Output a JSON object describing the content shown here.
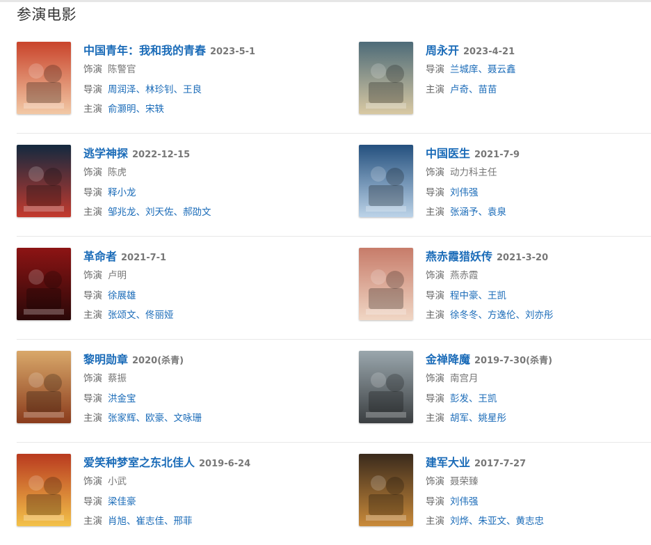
{
  "section": {
    "title": "参演电影"
  },
  "labels": {
    "role": "饰演",
    "director": "导演",
    "star": "主演"
  },
  "movies": [
    {
      "title": "中国青年：我和我的青春",
      "date": "2023-5-1",
      "lines": [
        {
          "type": "role",
          "label": "饰演",
          "items": [
            "陈警官"
          ]
        },
        {
          "type": "director",
          "label": "导演",
          "items": [
            "周润泽",
            "林珍钊",
            "王良"
          ]
        },
        {
          "type": "star",
          "label": "主演",
          "items": [
            "俞灏明",
            "宋轶"
          ]
        }
      ],
      "poster": {
        "icon": "movie-poster",
        "bg": "#c9442b",
        "bg2": "#f2c9a6"
      }
    },
    {
      "title": "周永开",
      "date": "2023-4-21",
      "lines": [
        {
          "type": "director",
          "label": "导演",
          "items": [
            "兰城庠",
            "聂云鑫"
          ]
        },
        {
          "type": "star",
          "label": "主演",
          "items": [
            "卢奇",
            "苗苗"
          ]
        }
      ],
      "poster": {
        "icon": "movie-poster",
        "bg": "#4d6b78",
        "bg2": "#d9c9a3"
      }
    },
    {
      "title": "逃学神探",
      "date": "2022-12-15",
      "lines": [
        {
          "type": "role",
          "label": "饰演",
          "items": [
            "陈虎"
          ]
        },
        {
          "type": "director",
          "label": "导演",
          "items": [
            "释小龙"
          ]
        },
        {
          "type": "star",
          "label": "主演",
          "items": [
            "邹兆龙",
            "刘天佐",
            "郝劭文"
          ]
        }
      ],
      "poster": {
        "icon": "movie-poster",
        "bg": "#13293f",
        "bg2": "#c43a2e"
      }
    },
    {
      "title": "中国医生",
      "date": "2021-7-9",
      "lines": [
        {
          "type": "role",
          "label": "饰演",
          "items": [
            "动力科主任"
          ]
        },
        {
          "type": "director",
          "label": "导演",
          "items": [
            "刘伟强"
          ]
        },
        {
          "type": "star",
          "label": "主演",
          "items": [
            "张涵予",
            "袁泉"
          ]
        }
      ],
      "poster": {
        "icon": "movie-poster",
        "bg": "#24507e",
        "bg2": "#bcd3e8"
      }
    },
    {
      "title": "革命者",
      "date": "2021-7-1",
      "lines": [
        {
          "type": "role",
          "label": "饰演",
          "items": [
            "卢明"
          ]
        },
        {
          "type": "director",
          "label": "导演",
          "items": [
            "徐展雄"
          ]
        },
        {
          "type": "star",
          "label": "主演",
          "items": [
            "张颂文",
            "佟丽娅"
          ]
        }
      ],
      "poster": {
        "icon": "movie-poster",
        "bg": "#8d1414",
        "bg2": "#2a0808"
      }
    },
    {
      "title": "燕赤霞猎妖传",
      "date": "2021-3-20",
      "lines": [
        {
          "type": "role",
          "label": "饰演",
          "items": [
            "燕赤霞"
          ]
        },
        {
          "type": "director",
          "label": "导演",
          "items": [
            "程中豪",
            "王凯"
          ]
        },
        {
          "type": "star",
          "label": "主演",
          "items": [
            "徐冬冬",
            "方逸伦",
            "刘亦彤"
          ]
        }
      ],
      "poster": {
        "icon": "movie-poster",
        "bg": "#c77c6a",
        "bg2": "#f0d6c4"
      }
    },
    {
      "title": "黎明勋章",
      "date": "2020(杀青)",
      "lines": [
        {
          "type": "role",
          "label": "饰演",
          "items": [
            "蔡振"
          ]
        },
        {
          "type": "director",
          "label": "导演",
          "items": [
            "洪金宝"
          ]
        },
        {
          "type": "star",
          "label": "主演",
          "items": [
            "张家辉",
            "欧豪",
            "文咏珊"
          ]
        }
      ],
      "poster": {
        "icon": "movie-poster",
        "bg": "#d9a86a",
        "bg2": "#8a3b1c"
      }
    },
    {
      "title": "金禅降魔",
      "date": "2019-7-30(杀青)",
      "lines": [
        {
          "type": "role",
          "label": "饰演",
          "items": [
            "南宫月"
          ]
        },
        {
          "type": "director",
          "label": "导演",
          "items": [
            "彭发",
            "王凯"
          ]
        },
        {
          "type": "star",
          "label": "主演",
          "items": [
            "胡军",
            "姚星彤"
          ]
        }
      ],
      "poster": {
        "icon": "movie-poster",
        "bg": "#9aa7ad",
        "bg2": "#3b3f41"
      }
    },
    {
      "title": "爱笑种梦室之东北佳人",
      "date": "2019-6-24",
      "lines": [
        {
          "type": "role",
          "label": "饰演",
          "items": [
            "小武"
          ]
        },
        {
          "type": "director",
          "label": "导演",
          "items": [
            "梁佳豪"
          ]
        },
        {
          "type": "star",
          "label": "主演",
          "items": [
            "肖旭",
            "崔志佳",
            "邢菲"
          ]
        }
      ],
      "poster": {
        "icon": "movie-poster",
        "bg": "#b93a1f",
        "bg2": "#f3c24a"
      }
    },
    {
      "title": "建军大业",
      "date": "2017-7-27",
      "lines": [
        {
          "type": "role",
          "label": "饰演",
          "items": [
            "聂荣臻"
          ]
        },
        {
          "type": "director",
          "label": "导演",
          "items": [
            "刘伟强"
          ]
        },
        {
          "type": "star",
          "label": "主演",
          "items": [
            "刘烨",
            "朱亚文",
            "黄志忠"
          ]
        }
      ],
      "poster": {
        "icon": "movie-poster",
        "bg": "#3a2a1c",
        "bg2": "#c98a3a"
      }
    }
  ]
}
